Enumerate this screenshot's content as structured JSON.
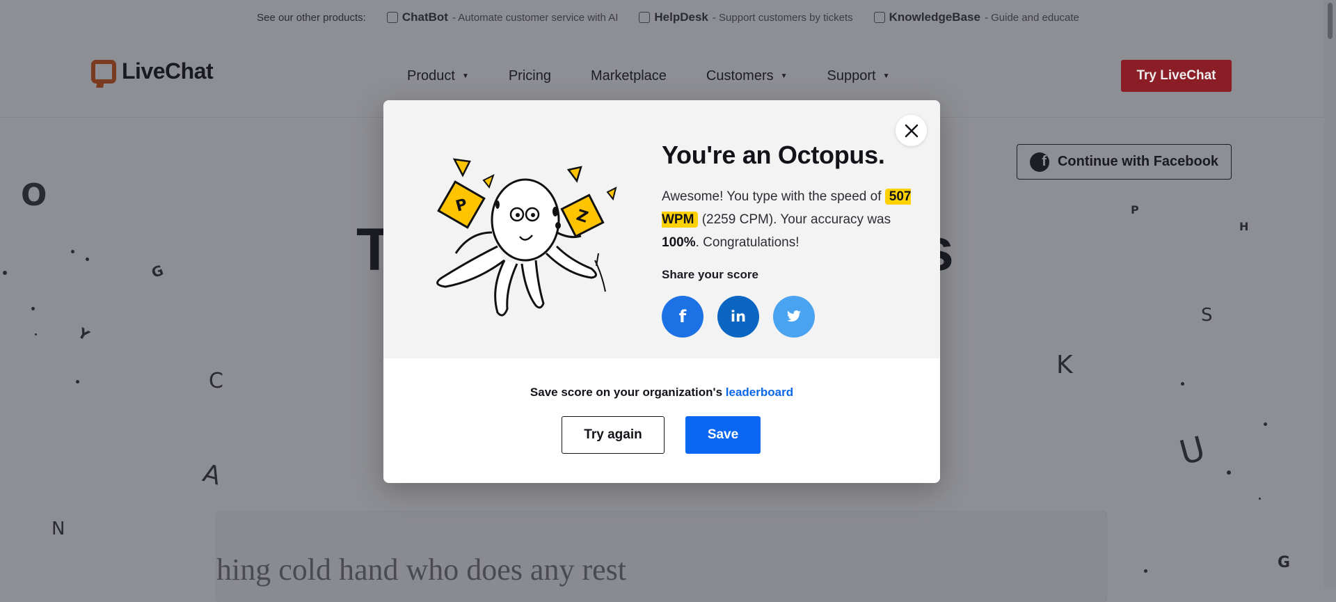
{
  "topbar": {
    "intro": "See our other products:",
    "products": [
      {
        "name": "ChatBot",
        "desc": "- Automate customer service with AI",
        "icon": "chatbot-icon"
      },
      {
        "name": "HelpDesk",
        "desc": "- Support customers by tickets",
        "icon": "helpdesk-icon"
      },
      {
        "name": "KnowledgeBase",
        "desc": "- Guide and educate",
        "icon": "knowledgebase-icon"
      }
    ]
  },
  "nav": {
    "logo": "LiveChat",
    "items": [
      "Product",
      "Pricing",
      "Marketplace",
      "Customers",
      "Support"
    ],
    "cta": "Try LiveChat"
  },
  "page": {
    "facebook_button": "Continue with Facebook",
    "heading_left": "T",
    "heading_right": "s",
    "typing_text": "hing cold hand who does any rest"
  },
  "modal": {
    "title": "You're an Octopus.",
    "text_before": "Awesome! You type with the speed of",
    "wpm": "507 WPM",
    "cpm": "(2259 CPM). Your accuracy was",
    "accuracy": "100%",
    "text_after": ". Congratulations!",
    "share_label": "Share your score",
    "share_icons": [
      "facebook-icon",
      "linkedin-icon",
      "twitter-icon"
    ],
    "save_text": "Save score on your organization's",
    "save_link": "leaderboard",
    "try_again": "Try again",
    "save": "Save"
  },
  "colors": {
    "overlay": "#8e8f94",
    "brand_red": "#8a1d26",
    "primary_blue": "#0a67f4",
    "badge_yellow": "#ffd100",
    "facebook": "#1c72e5",
    "linkedin": "#0a66c2",
    "twitter": "#4aa3f0"
  }
}
